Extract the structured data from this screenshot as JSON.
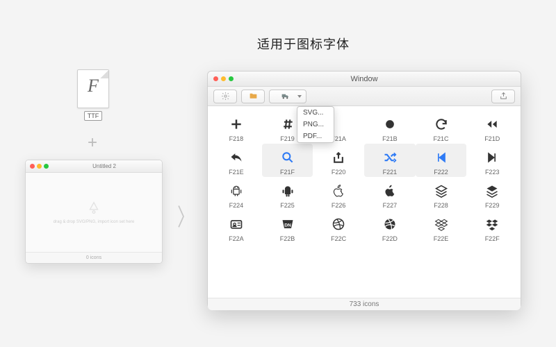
{
  "heading": "适用于图标字体",
  "ttf": {
    "glyph": "F",
    "label": "TTF"
  },
  "plus": "+",
  "arrow": "〉",
  "emptyWindow": {
    "title": "Untitled 2",
    "hint": "drag & drop SVG/PNG, import icon set here",
    "footer": "0 icons"
  },
  "mainWindow": {
    "title": "Window",
    "exportMenu": [
      "SVG...",
      "PNG...",
      "PDF..."
    ],
    "footer": "733 icons"
  },
  "icons": {
    "r0": [
      {
        "code": "F218",
        "name": "plus-icon"
      },
      {
        "code": "F219",
        "name": "hash-icon"
      },
      {
        "code": "F21A",
        "name": "blank-icon"
      },
      {
        "code": "F21B",
        "name": "circle-icon"
      },
      {
        "code": "F21C",
        "name": "refresh-icon"
      },
      {
        "code": "F21D",
        "name": "rewind-icon"
      }
    ],
    "r1": [
      {
        "code": "F21E",
        "name": "reply-icon"
      },
      {
        "code": "F21F",
        "name": "search-icon",
        "sel": true,
        "blue": true
      },
      {
        "code": "F220",
        "name": "share-icon"
      },
      {
        "code": "F221",
        "name": "shuffle-icon",
        "sel": true,
        "blue": true
      },
      {
        "code": "F222",
        "name": "skip-back-icon",
        "sel": true,
        "blue": true
      },
      {
        "code": "F223",
        "name": "skip-forward-icon"
      }
    ],
    "r2": [
      {
        "code": "F224",
        "name": "android-icon"
      },
      {
        "code": "F225",
        "name": "android-alt-icon"
      },
      {
        "code": "F226",
        "name": "apple-outline-icon"
      },
      {
        "code": "F227",
        "name": "apple-icon"
      },
      {
        "code": "F228",
        "name": "layers-icon"
      },
      {
        "code": "F229",
        "name": "layers-alt-icon"
      }
    ],
    "r3": [
      {
        "code": "F22A",
        "name": "id-icon"
      },
      {
        "code": "F22B",
        "name": "dn-icon"
      },
      {
        "code": "F22C",
        "name": "dribbble-icon"
      },
      {
        "code": "F22D",
        "name": "dribbble-alt-icon"
      },
      {
        "code": "F22E",
        "name": "dropbox-outline-icon"
      },
      {
        "code": "F22F",
        "name": "dropbox-icon"
      }
    ]
  }
}
